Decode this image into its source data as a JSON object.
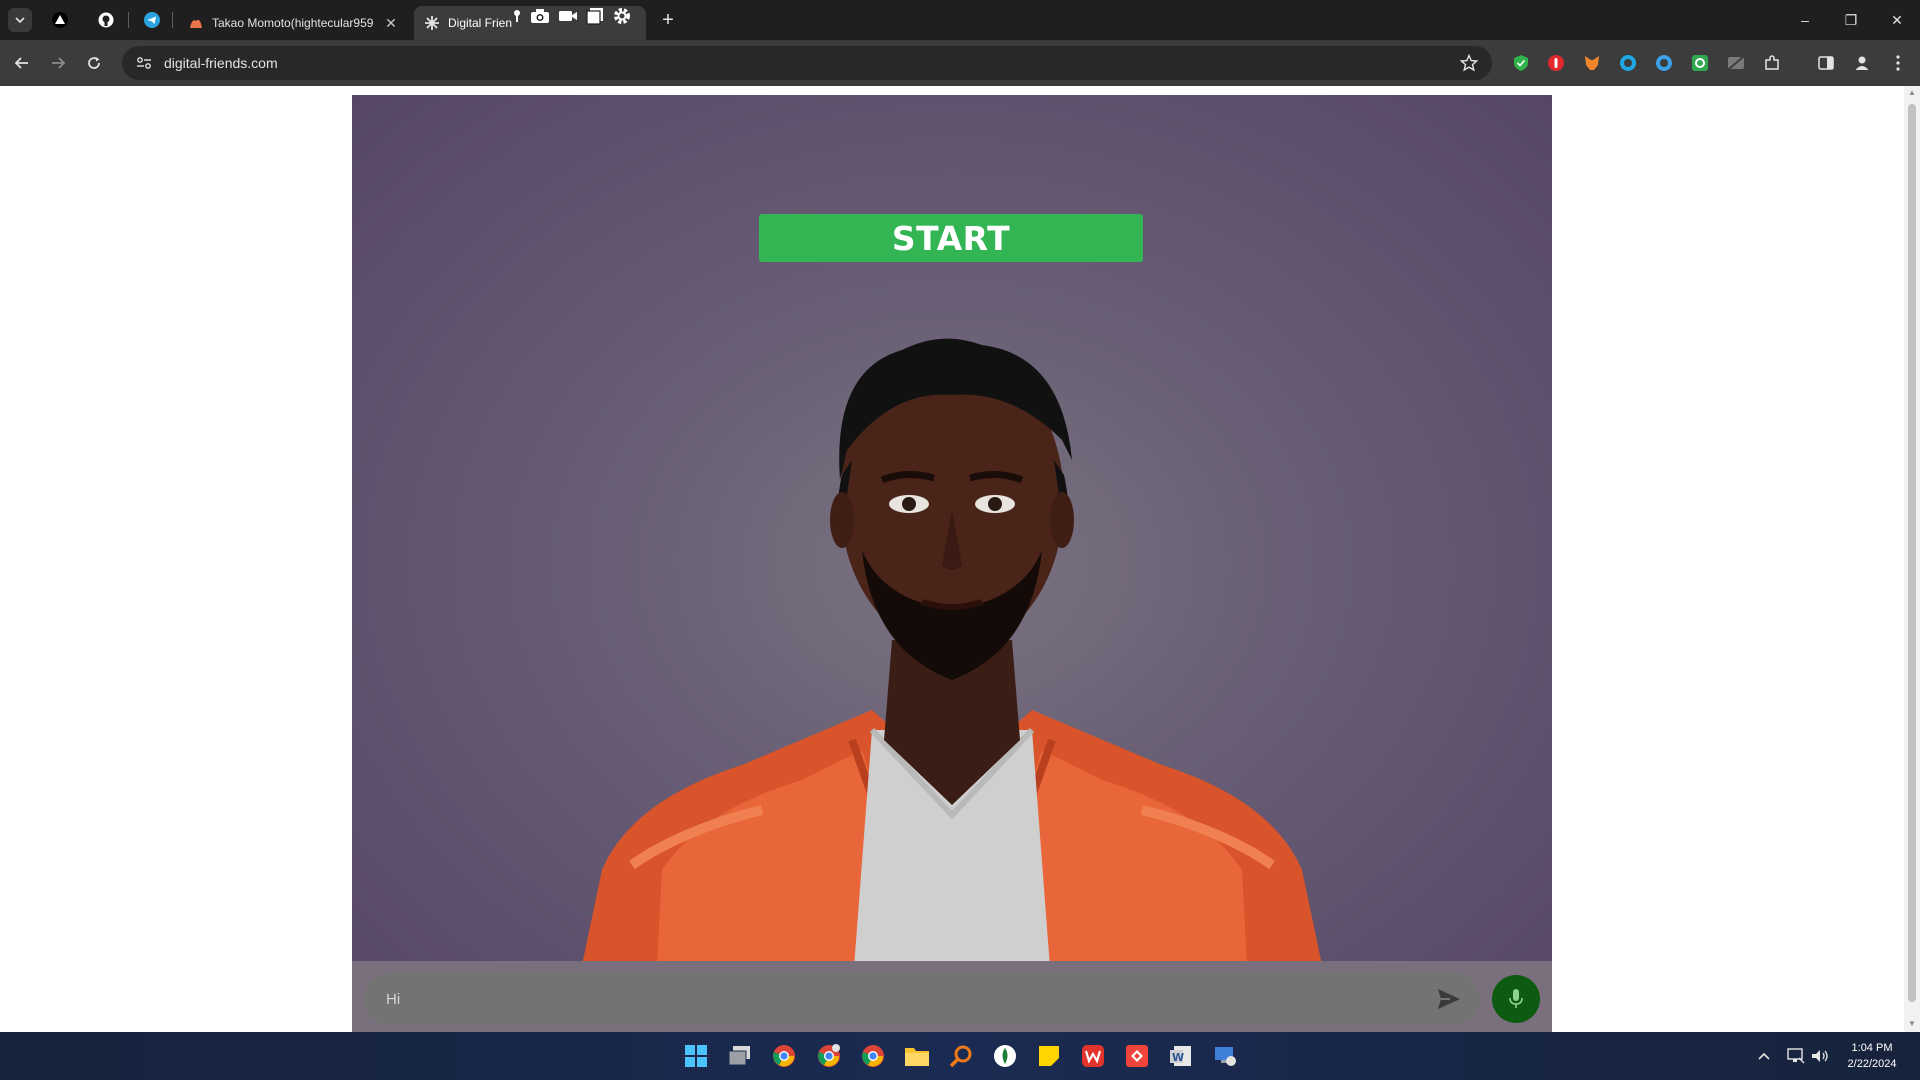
{
  "browser": {
    "tabs": [
      {
        "title": "Takao Momoto(hightecular959"
      },
      {
        "title": "Digital Frien"
      }
    ],
    "new_tab_label": "+",
    "close_glyph": "✕",
    "url": "digital-friends.com",
    "window_controls": {
      "minimize": "–",
      "restore": "❐",
      "close": "✕"
    }
  },
  "page": {
    "start_button_label": "START",
    "chat_input": {
      "value": "Hi",
      "placeholder": ""
    },
    "colors": {
      "start_button": "#33b554",
      "mic_button": "#0e5a10",
      "stage_bg": "#675c74"
    }
  },
  "taskbar": {
    "time": "1:04 PM",
    "date": "2/22/2024"
  }
}
